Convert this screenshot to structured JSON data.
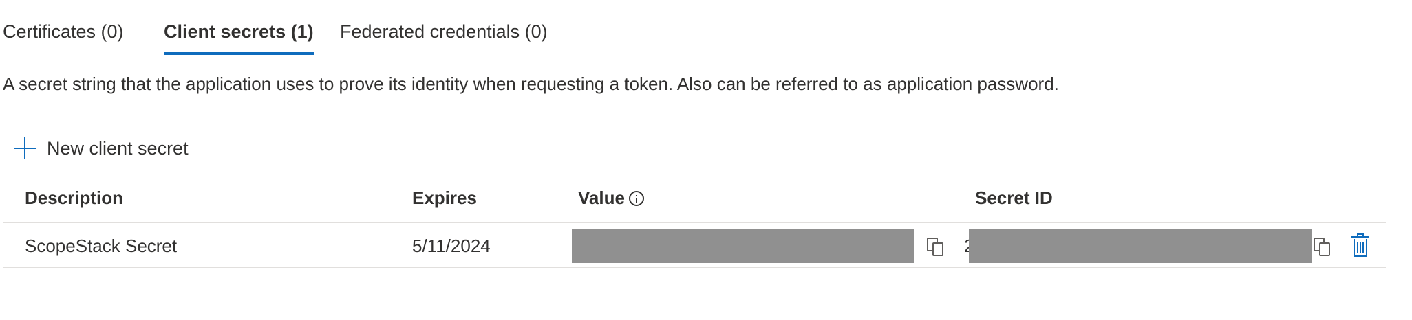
{
  "tabs": [
    {
      "label": "Certificates (0)",
      "active": false
    },
    {
      "label": "Client secrets (1)",
      "active": true
    },
    {
      "label": "Federated credentials (0)",
      "active": false
    }
  ],
  "description": "A secret string that the application uses to prove its identity when requesting a token. Also can be referred to as application password.",
  "toolbar": {
    "new_secret_label": "New client secret",
    "icon": "plus-icon"
  },
  "table": {
    "headers": {
      "description": "Description",
      "expires": "Expires",
      "value": "Value",
      "secret_id": "Secret ID"
    },
    "rows": [
      {
        "description": "ScopeStack Secret",
        "expires": "5/11/2024",
        "value": "[redacted]",
        "secret_id_visible_prefix": "2",
        "secret_id": "[redacted]"
      }
    ]
  },
  "colors": {
    "accent": "#0f6cbd",
    "text": "#323130",
    "redaction": "#909090",
    "divider": "#e1dfdd"
  }
}
